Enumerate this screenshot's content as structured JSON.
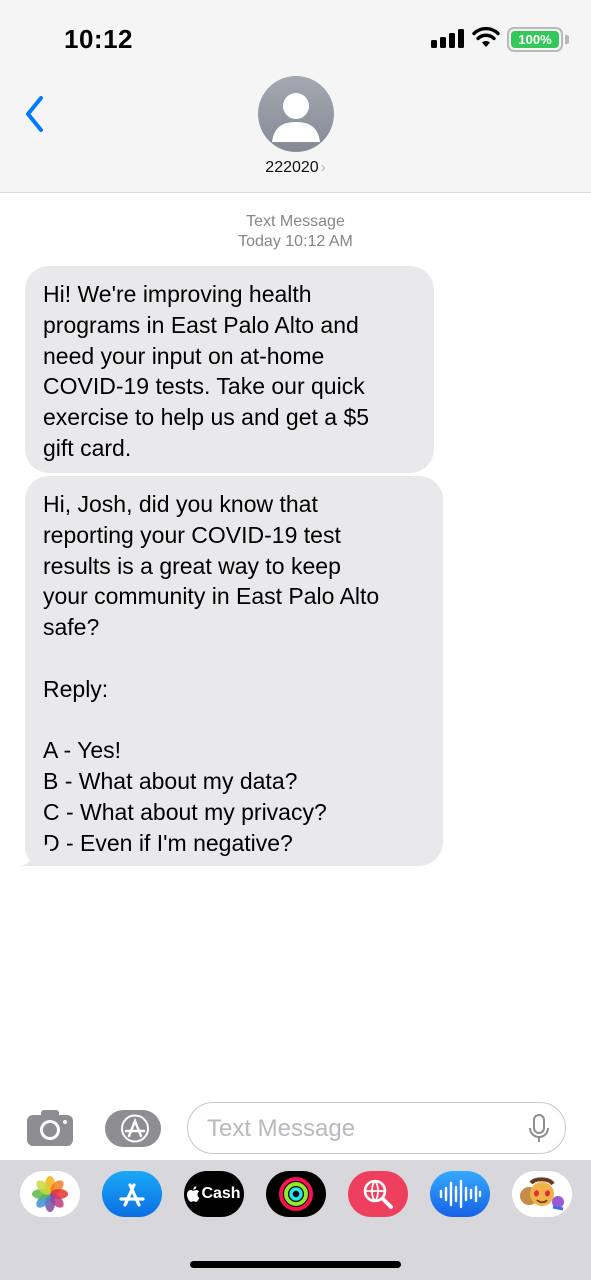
{
  "status_bar": {
    "time": "10:12",
    "battery": "100%"
  },
  "contact": {
    "name": "222020",
    "chevron": "›"
  },
  "conversation": {
    "type_label": "Text Message",
    "timestamp": "Today 10:12 AM",
    "messages": [
      {
        "text": "Hi! We're improving health\nprograms in East Palo Alto and\nneed your input on at-home\nCOVID-19 tests. Take our quick\nexercise to help us and get a $5\ngift card."
      },
      {
        "text": "Hi, Josh, did you know that\nreporting your COVID-19 test\nresults is a great way to keep\nyour community in East Palo Alto\nsafe?\n\nReply:\n\nA - Yes!\nB - What about my data?\nC - What about my privacy?\nD - Even if I'm negative?"
      }
    ]
  },
  "input_bar": {
    "placeholder": "Text Message"
  },
  "app_drawer": {
    "apps": [
      {
        "icon": "photos-icon"
      },
      {
        "icon": "app-store-icon"
      },
      {
        "icon": "cash-app-icon",
        "label": "Cash"
      },
      {
        "icon": "activity-icon"
      },
      {
        "icon": "web-search-icon"
      },
      {
        "icon": "audio-message-icon"
      },
      {
        "icon": "memoji-stickers-icon"
      }
    ]
  },
  "colors": {
    "accent": "#007aff",
    "bubble": "#e9e9eb",
    "battery": "#34c759"
  }
}
